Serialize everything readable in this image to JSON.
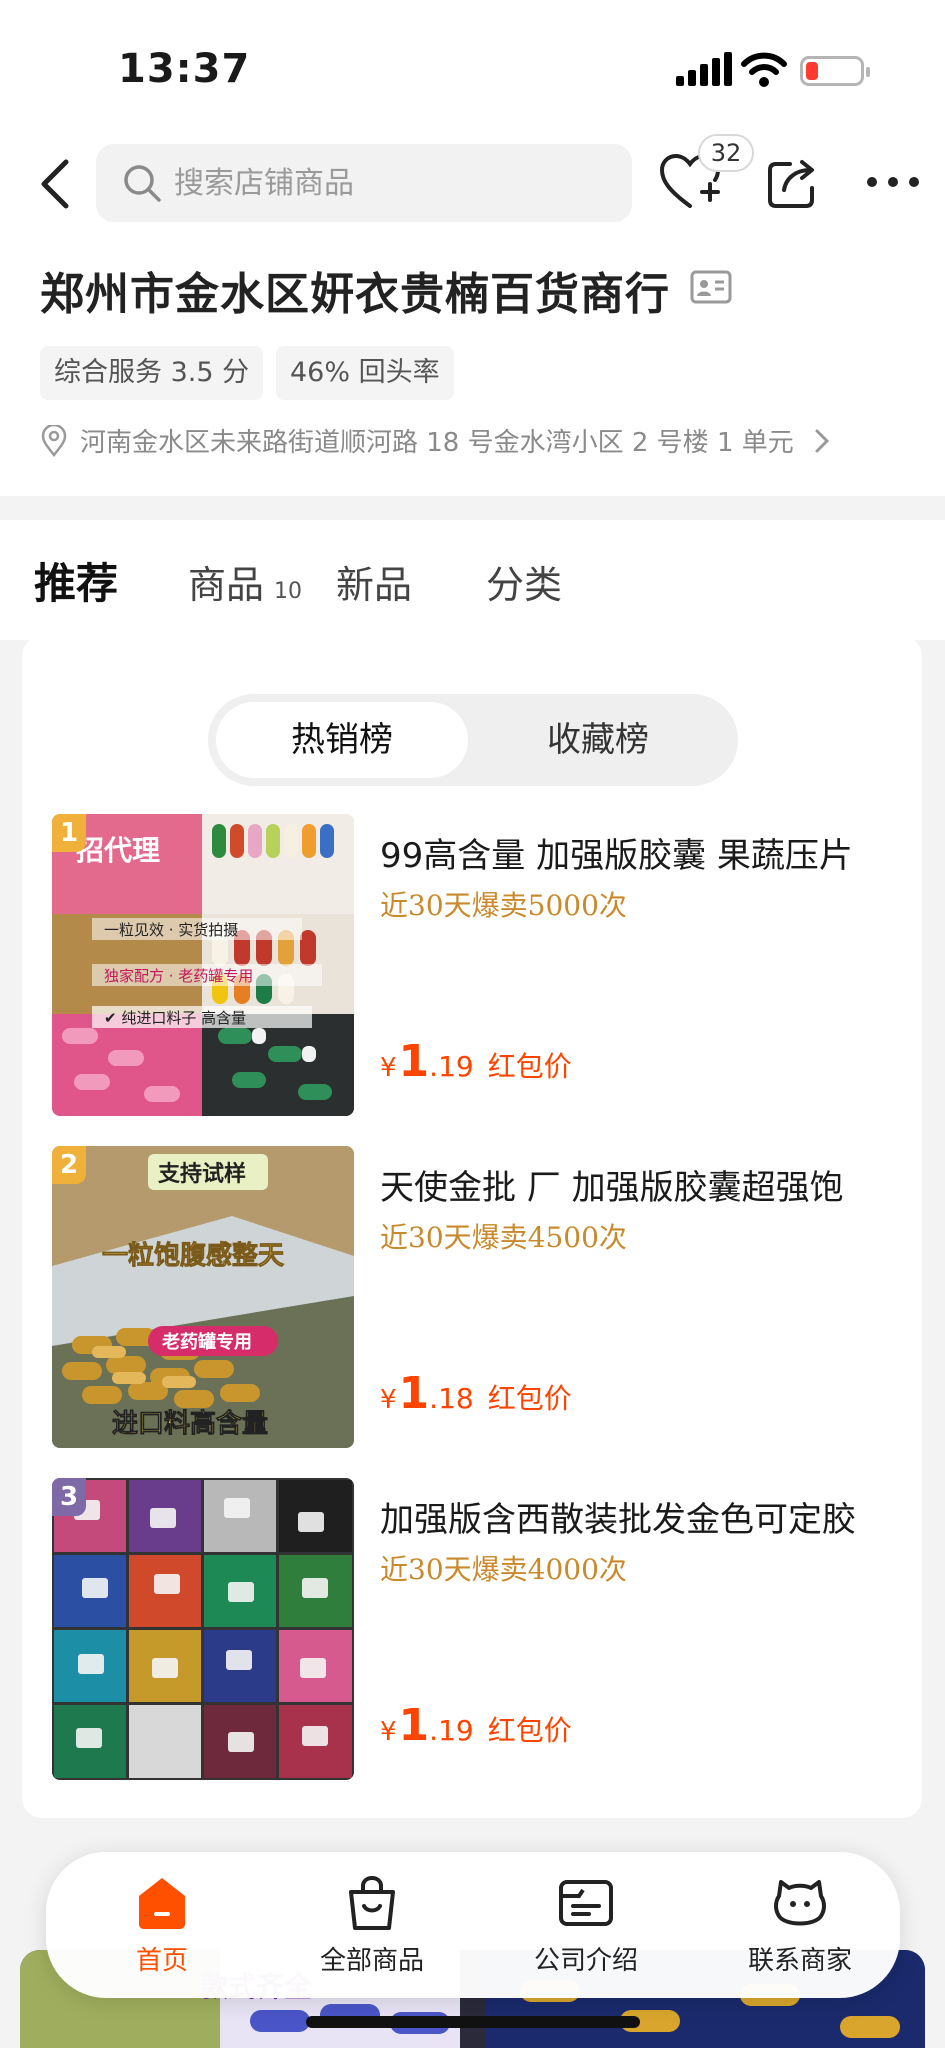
{
  "status_bar": {
    "time": "13:37"
  },
  "search": {
    "placeholder": "搜索店铺商品"
  },
  "favorites": {
    "count": "32"
  },
  "store": {
    "name": "郑州市金水区姸衣贵楠百货商行",
    "tags": [
      "综合服务 3.5 分",
      "46% 回头率"
    ],
    "address": "河南金水区未来路街道顺河路 18 号金水湾小区 2 号楼 1 单元"
  },
  "tabs": [
    {
      "label": "推荐",
      "active": true
    },
    {
      "label": "商品",
      "count": "10"
    },
    {
      "label": "新品"
    },
    {
      "label": "分类"
    }
  ],
  "ranking": {
    "options": [
      "热销榜",
      "收藏榜"
    ],
    "selected": "热销榜",
    "items": [
      {
        "rank": "1",
        "title": "99高含量 加强版胶囊  果蔬压片",
        "sold": "近30天爆卖5000次",
        "currency": "¥",
        "price_int": "1",
        "price_dec": ".19",
        "price_label": "红包价",
        "img_text": [
          "招代理",
          "一粒见效 · 实货拍摄",
          "独家配方 · 老药罐专用",
          "✔ 纯进口料子 高含量"
        ]
      },
      {
        "rank": "2",
        "title": "天使金批 厂 加强版胶囊超强饱",
        "sold": "近30天爆卖4500次",
        "currency": "¥",
        "price_int": "1",
        "price_dec": ".18",
        "price_label": "红包价",
        "img_text": [
          "支持试样",
          "一粒饱腹感整天",
          "老药罐专用",
          "进口料高含量"
        ]
      },
      {
        "rank": "3",
        "title": "加强版含西散装批发金色可定胶",
        "sold": "近30天爆卖4000次",
        "currency": "¥",
        "price_int": "1",
        "price_dec": ".19",
        "price_label": "红包价"
      }
    ]
  },
  "bottom_nav": [
    {
      "label": "首页",
      "icon": "home-icon",
      "active": true
    },
    {
      "label": "全部商品",
      "icon": "shopping-bag-icon"
    },
    {
      "label": "公司介绍",
      "icon": "company-card-icon"
    },
    {
      "label": "联系商家",
      "icon": "chat-face-icon"
    }
  ],
  "peek_banner": {
    "text": "款式齐全"
  },
  "colors": {
    "accent": "#ff5000",
    "price": "#ff4400",
    "sold": "#c98a2c"
  }
}
